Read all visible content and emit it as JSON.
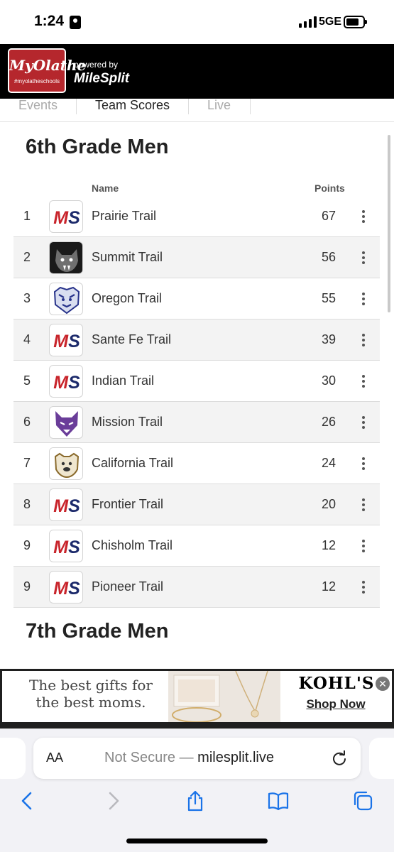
{
  "status": {
    "time": "1:24",
    "network": "5GE"
  },
  "header": {
    "logo_text": "MyOlathe",
    "logo_tag": "#myolatheschools",
    "powered_by": "powered by",
    "brand": "MileSplit"
  },
  "tabs": [
    {
      "label": "Events"
    },
    {
      "label": "Team Scores"
    },
    {
      "label": "Live"
    }
  ],
  "sections": [
    {
      "title": "6th Grade Men",
      "columns": {
        "name": "Name",
        "points": "Points"
      },
      "rows": [
        {
          "rank": "1",
          "team": "Prairie Trail",
          "points": "67",
          "logo": "milesplit-logo"
        },
        {
          "rank": "2",
          "team": "Summit Trail",
          "points": "56",
          "logo": "panther-logo"
        },
        {
          "rank": "3",
          "team": "Oregon Trail",
          "points": "55",
          "logo": "tiger-logo"
        },
        {
          "rank": "4",
          "team": "Sante Fe Trail",
          "points": "39",
          "logo": "milesplit-logo"
        },
        {
          "rank": "5",
          "team": "Indian Trail",
          "points": "30",
          "logo": "milesplit-logo"
        },
        {
          "rank": "6",
          "team": "Mission Trail",
          "points": "26",
          "logo": "wolf-logo"
        },
        {
          "rank": "7",
          "team": "California Trail",
          "points": "24",
          "logo": "bulldog-logo"
        },
        {
          "rank": "8",
          "team": "Frontier Trail",
          "points": "20",
          "logo": "milesplit-logo"
        },
        {
          "rank": "9",
          "team": "Chisholm Trail",
          "points": "12",
          "logo": "milesplit-logo"
        },
        {
          "rank": "9",
          "team": "Pioneer Trail",
          "points": "12",
          "logo": "milesplit-logo"
        }
      ]
    },
    {
      "title": "7th Grade Men"
    }
  ],
  "ad": {
    "text": "The best gifts for the best moms.",
    "brand": "KOHL'S",
    "cta": "Shop Now"
  },
  "browser": {
    "aa": "AA",
    "url_prefix": "Not Secure —",
    "url": "milesplit.live"
  },
  "colors": {
    "header_bg": "#000000",
    "logo_red": "#b5272d",
    "ms_red": "#c8242b",
    "ms_navy": "#1c2a6b",
    "row_shade": "#f3f3f3",
    "ios_blue": "#1a73e8"
  }
}
